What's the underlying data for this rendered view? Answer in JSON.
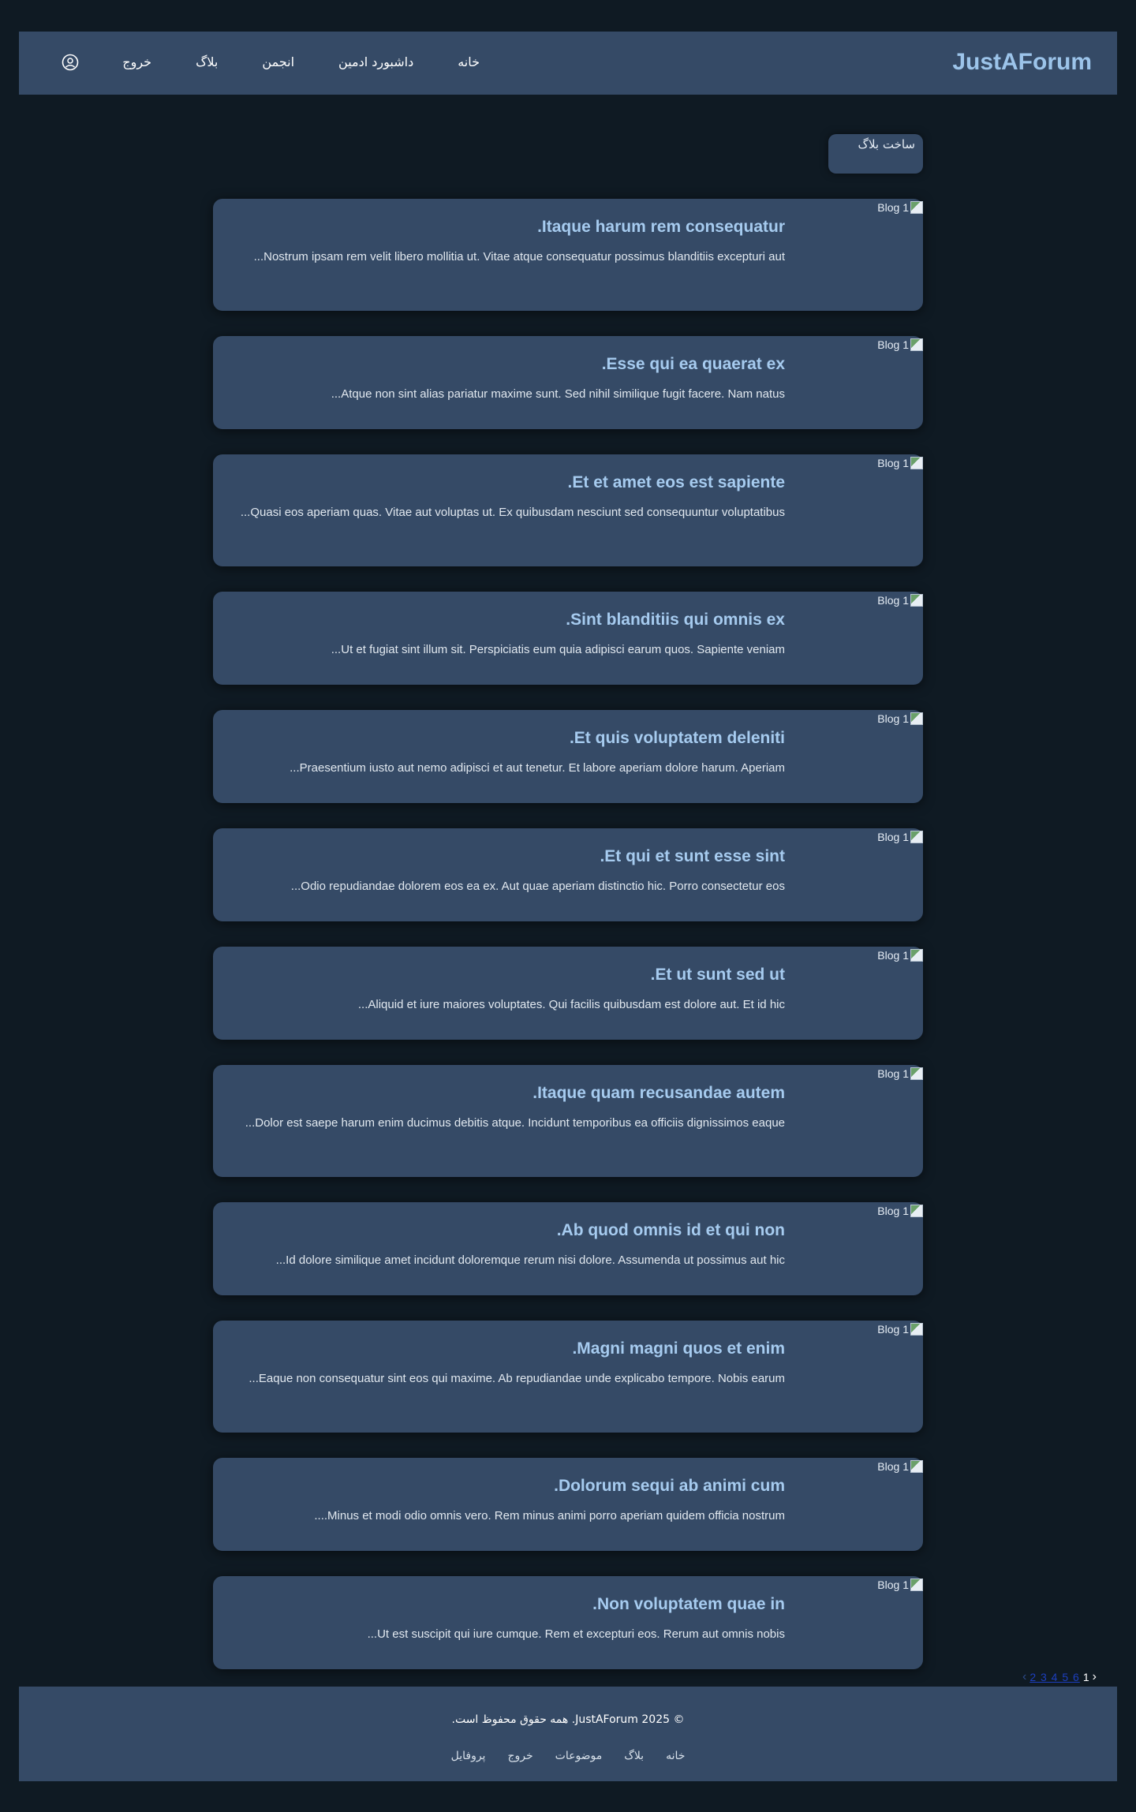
{
  "header": {
    "brand": "JustAForum",
    "nav": [
      "خانه",
      "داشبورد ادمین",
      "انجمن",
      "بلاگ",
      "خروج"
    ],
    "user_icon": "user-circle-icon"
  },
  "create_blog_label": "ساخت بلاگ",
  "image_alt": "Blog 1",
  "posts": [
    {
      "title": "Itaque harum rem consequatur.",
      "excerpt": "Nostrum ipsam rem velit libero mollitia ut. Vitae atque consequatur possimus blanditiis excepturi aut..."
    },
    {
      "title": "Esse qui ea quaerat ex.",
      "excerpt": "Atque non sint alias pariatur maxime sunt. Sed nihil similique fugit facere. Nam natus..."
    },
    {
      "title": "Et et amet eos est sapiente.",
      "excerpt": "Quasi eos aperiam quas. Vitae aut voluptas ut. Ex quibusdam nesciunt sed consequuntur voluptatibus..."
    },
    {
      "title": "Sint blanditiis qui omnis ex.",
      "excerpt": "Ut et fugiat sint illum sit. Perspiciatis eum quia adipisci earum quos. Sapiente veniam..."
    },
    {
      "title": "Et quis voluptatem deleniti.",
      "excerpt": "Praesentium iusto aut nemo adipisci et aut tenetur. Et labore aperiam dolore harum. Aperiam..."
    },
    {
      "title": "Et qui et sunt esse sint.",
      "excerpt": "Odio repudiandae dolorem eos ea ex. Aut quae aperiam distinctio hic. Porro consectetur eos..."
    },
    {
      "title": "Et ut sunt sed ut.",
      "excerpt": "Aliquid et iure maiores voluptates. Qui facilis quibusdam est dolore aut. Et id hic..."
    },
    {
      "title": "Itaque quam recusandae autem.",
      "excerpt": "Dolor est saepe harum enim ducimus debitis atque. Incidunt temporibus ea officiis dignissimos eaque..."
    },
    {
      "title": "Ab quod omnis id et qui non.",
      "excerpt": "Id dolore similique amet incidunt doloremque rerum nisi dolore. Assumenda ut possimus aut hic..."
    },
    {
      "title": "Magni magni quos et enim.",
      "excerpt": "Eaque non consequatur sint eos qui maxime. Ab repudiandae unde explicabo tempore. Nobis earum..."
    },
    {
      "title": "Dolorum sequi ab animi cum.",
      "excerpt": "Minus et modi odio omnis vero. Rem minus animi porro aperiam quidem officia nostrum...."
    },
    {
      "title": "Non voluptatem quae in.",
      "excerpt": "Ut est suscipit qui iure cumque. Rem et excepturi eos. Rerum aut omnis nobis..."
    }
  ],
  "pagination": {
    "prev": "‹",
    "current": "1",
    "pages": "2 3 4 5 6",
    "next": "›"
  },
  "footer": {
    "copyright": "© 2025 JustAForum. همه حقوق محفوظ است.",
    "links": [
      "خانه",
      "بلاگ",
      "موضوعات",
      "خروج",
      "پروفایل"
    ]
  }
}
